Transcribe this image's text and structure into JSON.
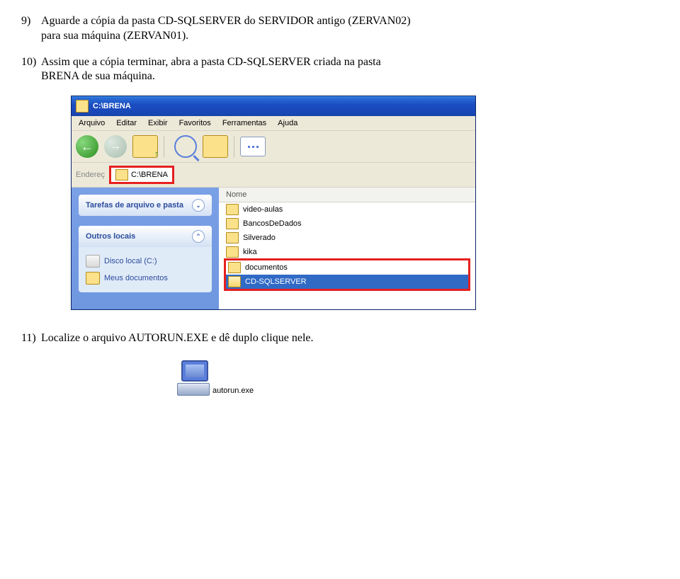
{
  "step9": {
    "num": "9)",
    "text_a": "Aguarde a cópia da pasta CD-SQLSERVER do SERVIDOR antigo (ZERVAN02)",
    "text_b": "para sua máquina (ZERVAN01)."
  },
  "step10": {
    "num": "10)",
    "text_a": "Assim que a cópia terminar, abra a pasta CD-SQLSERVER criada na pasta",
    "text_b": "BRENA de sua máquina."
  },
  "explorer": {
    "title": "C:\\BRENA",
    "menu": [
      "Arquivo",
      "Editar",
      "Exibir",
      "Favoritos",
      "Ferramentas",
      "Ajuda"
    ],
    "address_label": "Endereç",
    "address_value": "C:\\BRENA",
    "sidebar": {
      "panel1": {
        "title": "Tarefas de arquivo e pasta"
      },
      "panel2": {
        "title": "Outros locais",
        "items": [
          {
            "label": "Disco local (C:)",
            "cls": "disk"
          },
          {
            "label": "Meus documentos",
            "cls": "docs"
          }
        ]
      }
    },
    "list": {
      "header": "Nome",
      "rows": [
        {
          "label": "video-aulas",
          "sel": false
        },
        {
          "label": "BancosDeDados",
          "sel": false
        },
        {
          "label": "Silverado",
          "sel": false
        },
        {
          "label": "kika",
          "sel": false
        },
        {
          "label": "documentos",
          "sel": false,
          "grp": true
        },
        {
          "label": "CD-SQLSERVER",
          "sel": true,
          "grp": true
        }
      ]
    }
  },
  "step11": {
    "num": "11)",
    "text": "Localize o arquivo AUTORUN.EXE e dê duplo clique nele."
  },
  "autorun": {
    "label": "autorun.exe"
  }
}
